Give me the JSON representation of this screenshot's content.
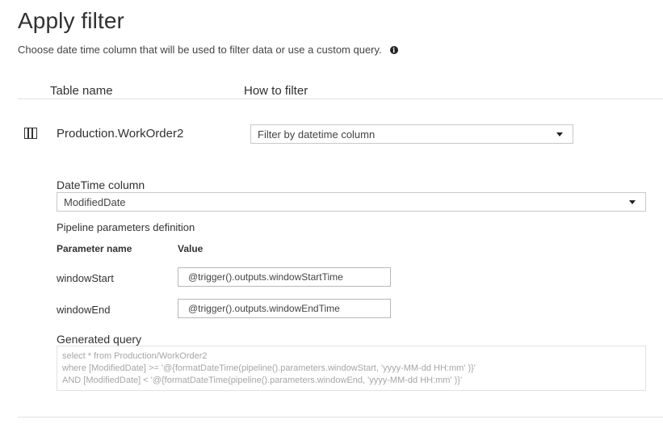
{
  "header": {
    "title": "Apply filter",
    "subtitle": "Choose date time column that will be used to filter data or use a custom query.",
    "info_icon": "info-icon"
  },
  "columns": {
    "table_name": "Table name",
    "how_to_filter": "How to filter"
  },
  "row": {
    "icon": "table-icon",
    "table_name": "Production.WorkOrder2",
    "filter_mode": "Filter by datetime column"
  },
  "datetime": {
    "label": "DateTime column",
    "value": "ModifiedDate"
  },
  "params": {
    "section_label": "Pipeline parameters definition",
    "header_name": "Parameter name",
    "header_value": "Value",
    "items": [
      {
        "name": "windowStart",
        "value": "@trigger().outputs.windowStartTime"
      },
      {
        "name": "windowEnd",
        "value": "@trigger().outputs.windowEndTime"
      }
    ]
  },
  "query": {
    "label": "Generated query",
    "lines": [
      "select * from Production/WorkOrder2",
      "where [ModifiedDate] >= '@{formatDateTime(pipeline().parameters.windowStart, 'yyyy-MM-dd HH:mm' )}'",
      "AND [ModifiedDate] < '@{formatDateTime(pipeline().parameters.windowEnd, 'yyyy-MM-dd HH:mm' )}'"
    ]
  }
}
